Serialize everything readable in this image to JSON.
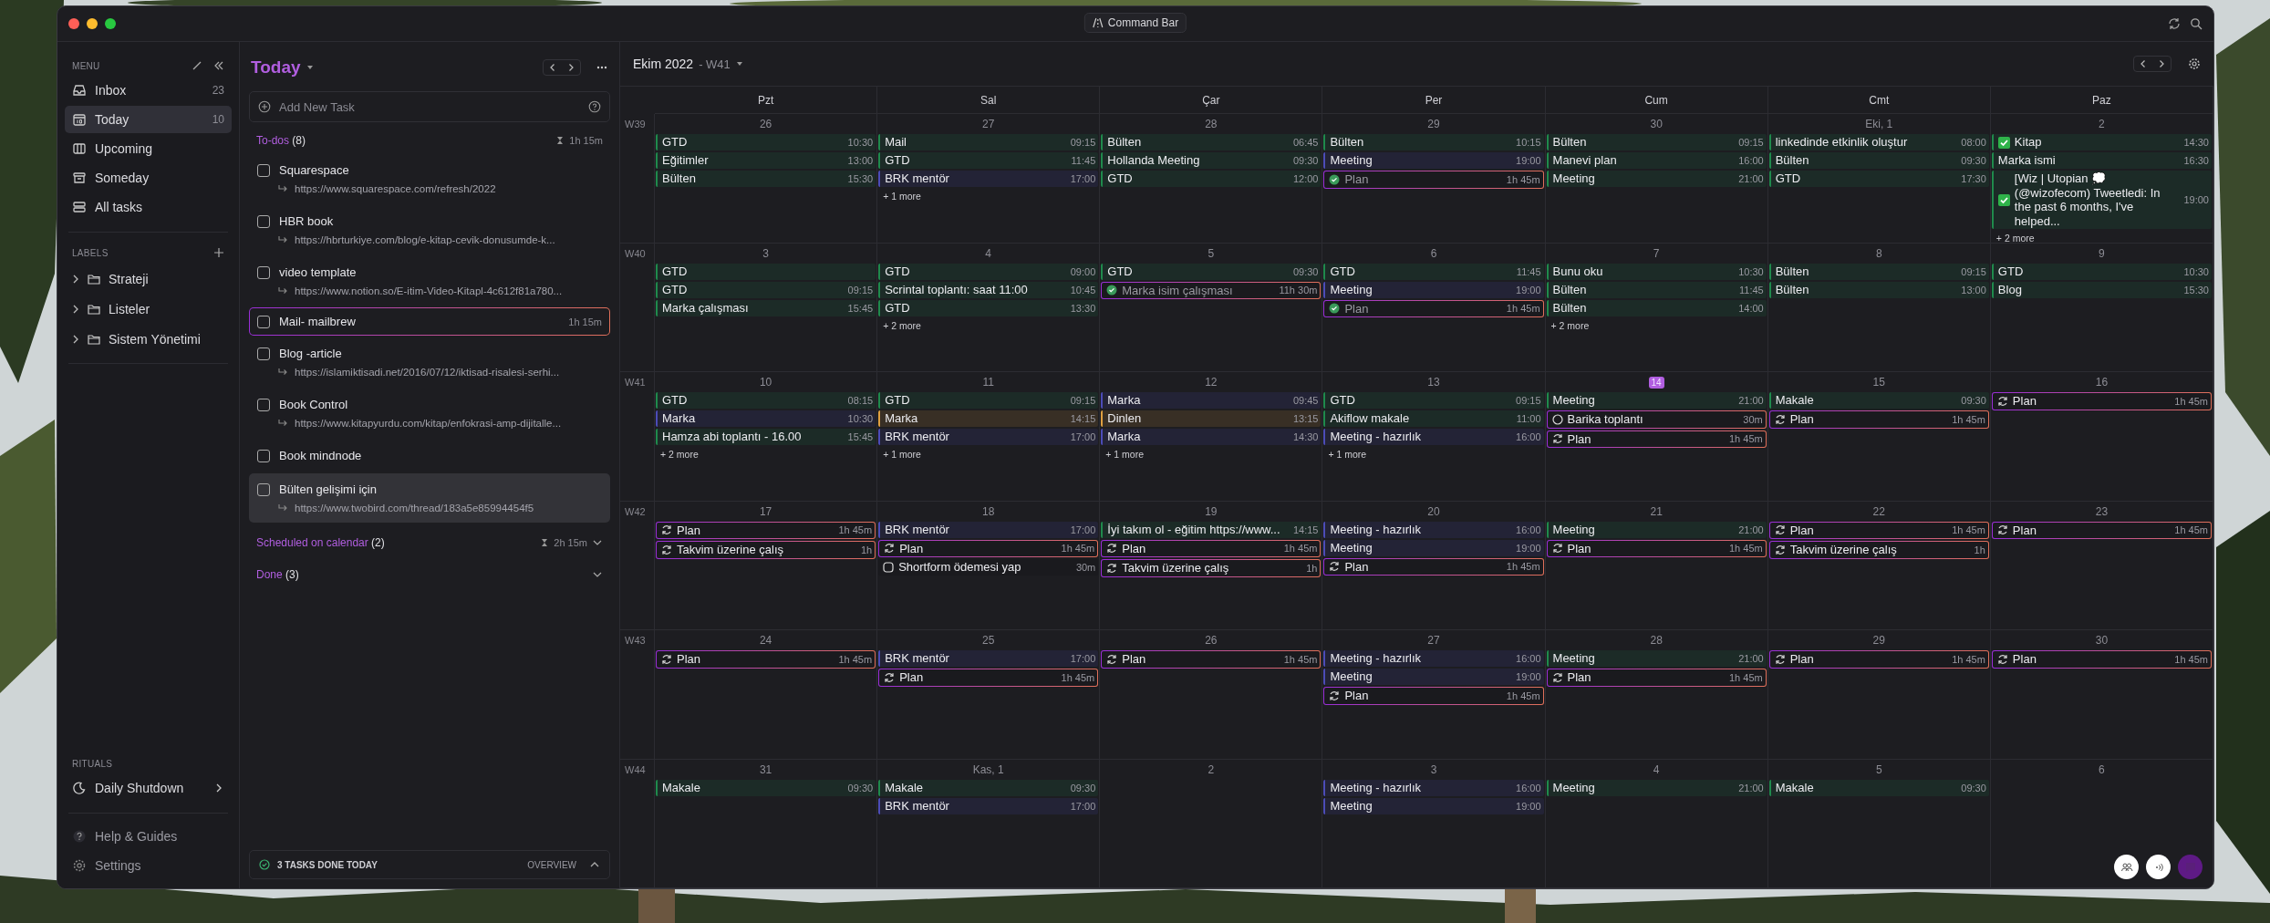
{
  "title_bar": {
    "command_bar": "Command Bar"
  },
  "sidebar": {
    "menu_heading": "MENU",
    "items": [
      {
        "label": "Inbox",
        "count": "23",
        "selected": false
      },
      {
        "label": "Today",
        "count": "10",
        "selected": true
      },
      {
        "label": "Upcoming",
        "selected": false
      },
      {
        "label": "Someday",
        "selected": false
      },
      {
        "label": "All tasks",
        "selected": false
      }
    ],
    "labels_heading": "LABELS",
    "labels": [
      {
        "label": "Strateji",
        "expanded": false
      },
      {
        "label": "Listeler",
        "expanded": false
      },
      {
        "label": "Sistem Yönetimi",
        "expanded": false
      }
    ],
    "rituals_heading": "RITUALS",
    "rituals": [
      {
        "label": "Daily Shutdown"
      }
    ],
    "footer": [
      {
        "label": "Help & Guides"
      },
      {
        "label": "Settings"
      }
    ]
  },
  "task_panel": {
    "title": "Today",
    "add_task": {
      "placeholder": "Add New Task"
    },
    "todos": {
      "label": "To-dos",
      "count": "(8)",
      "duration": "1h 15m"
    },
    "tasks": [
      {
        "title": "Squarespace",
        "url": "https://www.squarespace.com/refresh/2022",
        "scheduled": false,
        "checked": false,
        "selected": false
      },
      {
        "title": "HBR book",
        "url": "https://hbrturkiye.com/blog/e-kitap-cevik-donusumde-k...",
        "scheduled": false,
        "checked": false,
        "selected": false
      },
      {
        "title": "video template",
        "url": "https://www.notion.so/E-itim-Video-Kitapl-4c612f81a780...",
        "scheduled": false,
        "checked": false,
        "selected": false
      },
      {
        "title": "Mail- mailbrew",
        "duration": "1h 15m",
        "scheduled": true,
        "checked": false,
        "selected": false
      },
      {
        "title": "Blog -article",
        "url": "https://islamiktisadi.net/2016/07/12/iktisad-risalesi-serhi...",
        "scheduled": false,
        "checked": false,
        "selected": false
      },
      {
        "title": "Book Control",
        "url": "https://www.kitapyurdu.com/kitap/enfokrasi-amp-dijitalle...",
        "scheduled": false,
        "checked": false,
        "selected": false
      },
      {
        "title": "Book mindnode",
        "scheduled": false,
        "checked": false,
        "selected": false
      },
      {
        "title": "Bülten gelişimi için",
        "url": "https://www.twobird.com/thread/183a5e85994454f5",
        "scheduled": false,
        "checked": false,
        "selected": true
      }
    ],
    "scheduled": {
      "label": "Scheduled on calendar",
      "count": "(2)",
      "duration": "2h 15m",
      "expanded": false
    },
    "done": {
      "label": "Done",
      "count": "(3)",
      "expanded": false
    },
    "footer": {
      "summary": "3 TASKS DONE TODAY",
      "overview": "OVERVIEW"
    }
  },
  "calendar": {
    "month": "Ekim 2022",
    "week": "- W41",
    "day_names": [
      "Pzt",
      "Sal",
      "Çar",
      "Per",
      "Cum",
      "Cmt",
      "Paz"
    ],
    "weeks": [
      {
        "label": "W39",
        "days": [
          {
            "date": "26",
            "events": [
              {
                "kind": "event",
                "title": "GTD",
                "time": "10:30",
                "color": "#1f8a4c"
              },
              {
                "kind": "event",
                "title": "Eğitimler",
                "time": "13:00",
                "color": "#1f8a4c"
              },
              {
                "kind": "event",
                "title": "Bülten",
                "time": "15:30",
                "color": "#1f8a4c"
              }
            ]
          },
          {
            "date": "27",
            "events": [
              {
                "kind": "event",
                "title": "Mail",
                "time": "09:15",
                "color": "#1f8a4c"
              },
              {
                "kind": "event",
                "title": "GTD",
                "time": "11:45",
                "color": "#1f8a4c"
              },
              {
                "kind": "event",
                "title": "BRK mentör",
                "time": "17:00",
                "color": "#4c4cb8"
              }
            ],
            "more": "+ 1 more"
          },
          {
            "date": "28",
            "events": [
              {
                "kind": "event",
                "title": "Bülten",
                "time": "06:45",
                "color": "#1f8a4c"
              },
              {
                "kind": "event",
                "title": "Hollanda Meeting",
                "time": "09:30",
                "color": "#1f8a4c"
              },
              {
                "kind": "event",
                "title": "GTD",
                "time": "12:00",
                "color": "#1f8a4c"
              }
            ]
          },
          {
            "date": "29",
            "events": [
              {
                "kind": "event",
                "title": "Bülten",
                "time": "10:15",
                "color": "#1f8a4c"
              },
              {
                "kind": "event",
                "title": "Meeting",
                "time": "19:00",
                "color": "#4c4cb8"
              },
              {
                "kind": "task",
                "title": "Plan",
                "duration": "1h 45m",
                "checked": true
              }
            ]
          },
          {
            "date": "30",
            "events": [
              {
                "kind": "event",
                "title": "Bülten",
                "time": "09:15",
                "color": "#1f8a4c"
              },
              {
                "kind": "event",
                "title": "Manevi plan",
                "time": "16:00",
                "color": "#1f8a4c"
              },
              {
                "kind": "event",
                "title": "Meeting",
                "time": "21:00",
                "color": "#1f8a4c"
              }
            ]
          },
          {
            "date": "Eki, 1",
            "events": [
              {
                "kind": "event",
                "title": "linkedinde etkinlik oluştur",
                "time": "08:00",
                "color": "#1f8a4c"
              },
              {
                "kind": "event",
                "title": "Bülten",
                "time": "09:30",
                "color": "#1f8a4c"
              },
              {
                "kind": "event",
                "title": "GTD",
                "time": "17:30",
                "color": "#1f8a4c"
              }
            ]
          },
          {
            "date": "2",
            "events": [
              {
                "kind": "event",
                "title": "Kitap",
                "time": "14:30",
                "color": "#1f8a4c",
                "done": true
              },
              {
                "kind": "event",
                "title": "Marka ismi",
                "time": "16:30",
                "color": "#1f8a4c"
              },
              {
                "kind": "event",
                "title": "[Wiz | Utopian 💭 (@wizofecom) Tweetledi: In the past 6 months, I've helped...",
                "time": "19:00",
                "color": "#1f8a4c",
                "done": true
              }
            ],
            "more": "+ 2 more"
          }
        ]
      },
      {
        "label": "W40",
        "days": [
          {
            "date": "3",
            "events": [
              {
                "kind": "event",
                "title": "GTD",
                "color": "#1f8a4c"
              },
              {
                "kind": "event",
                "title": "GTD",
                "time": "09:15",
                "color": "#1f8a4c"
              },
              {
                "kind": "event",
                "title": "Marka çalışması",
                "time": "15:45",
                "color": "#1f8a4c"
              }
            ]
          },
          {
            "date": "4",
            "events": [
              {
                "kind": "event",
                "title": "GTD",
                "time": "09:00",
                "color": "#1f8a4c"
              },
              {
                "kind": "event",
                "title": "Scrintal toplantı: saat 11:00",
                "time": "10:45",
                "color": "#1f8a4c"
              },
              {
                "kind": "event",
                "title": "GTD",
                "time": "13:30",
                "color": "#1f8a4c"
              }
            ],
            "more": "+ 2 more"
          },
          {
            "date": "5",
            "events": [
              {
                "kind": "event",
                "title": "GTD",
                "time": "09:30",
                "color": "#1f8a4c"
              },
              {
                "kind": "task",
                "title": "Marka isim çalışması",
                "duration": "11h 30m",
                "checked": true
              }
            ]
          },
          {
            "date": "6",
            "events": [
              {
                "kind": "event",
                "title": "GTD",
                "time": "11:45",
                "color": "#1f8a4c"
              },
              {
                "kind": "event",
                "title": "Meeting",
                "time": "19:00",
                "color": "#4c4cb8"
              },
              {
                "kind": "task",
                "title": "Plan",
                "duration": "1h 45m",
                "checked": true
              }
            ]
          },
          {
            "date": "7",
            "events": [
              {
                "kind": "event",
                "title": "Bunu oku",
                "time": "10:30",
                "color": "#1f8a4c"
              },
              {
                "kind": "event",
                "title": "Bülten",
                "time": "11:45",
                "color": "#1f8a4c"
              },
              {
                "kind": "event",
                "title": "Bülten",
                "time": "14:00",
                "color": "#1f8a4c"
              }
            ],
            "more": "+ 2 more"
          },
          {
            "date": "8",
            "events": [
              {
                "kind": "event",
                "title": "Bülten",
                "time": "09:15",
                "color": "#1f8a4c"
              },
              {
                "kind": "event",
                "title": "Bülten",
                "time": "13:00",
                "color": "#1f8a4c"
              }
            ]
          },
          {
            "date": "9",
            "events": [
              {
                "kind": "event",
                "title": "GTD",
                "time": "10:30",
                "color": "#1f8a4c"
              },
              {
                "kind": "event",
                "title": "Blog",
                "time": "15:30",
                "color": "#1f8a4c"
              }
            ]
          }
        ]
      },
      {
        "label": "W41",
        "days": [
          {
            "date": "10",
            "events": [
              {
                "kind": "event",
                "title": "GTD",
                "time": "08:15",
                "color": "#1f8a4c"
              },
              {
                "kind": "event",
                "title": "Marka",
                "time": "10:30",
                "color": "#4c4cb8"
              },
              {
                "kind": "event",
                "title": "Hamza abi toplantı - 16.00",
                "time": "15:45",
                "color": "#1f8a4c"
              }
            ],
            "more": "+ 2 more"
          },
          {
            "date": "11",
            "events": [
              {
                "kind": "event",
                "title": "GTD",
                "time": "09:15",
                "color": "#1f8a4c"
              },
              {
                "kind": "event",
                "title": "Marka",
                "time": "14:15",
                "color": "#e0a040"
              },
              {
                "kind": "event",
                "title": "BRK mentör",
                "time": "17:00",
                "color": "#4c4cb8"
              }
            ],
            "more": "+ 1 more"
          },
          {
            "date": "12",
            "events": [
              {
                "kind": "event",
                "title": "Marka",
                "time": "09:45",
                "color": "#4c4cb8"
              },
              {
                "kind": "event",
                "title": "Dinlen",
                "time": "13:15",
                "color": "#e0a040"
              },
              {
                "kind": "event",
                "title": "Marka",
                "time": "14:30",
                "color": "#4c4cb8"
              }
            ],
            "more": "+ 1 more"
          },
          {
            "date": "13",
            "events": [
              {
                "kind": "event",
                "title": "GTD",
                "time": "09:15",
                "color": "#1f8a4c"
              },
              {
                "kind": "event",
                "title": "Akiflow makale",
                "time": "11:00",
                "color": "#1f8a4c"
              },
              {
                "kind": "event",
                "title": "Meeting - hazırlık",
                "time": "16:00",
                "color": "#4c4cb8"
              }
            ],
            "more": "+ 1 more"
          },
          {
            "date": "14",
            "today": true,
            "events": [
              {
                "kind": "event",
                "title": "Meeting",
                "time": "21:00",
                "color": "#1f8a4c"
              },
              {
                "kind": "task",
                "title": "Barika toplantı",
                "duration": "30m",
                "checked": false,
                "recurring": false
              },
              {
                "kind": "task",
                "title": "Plan",
                "duration": "1h 45m",
                "checked": false,
                "recurring": true
              }
            ]
          },
          {
            "date": "15",
            "events": [
              {
                "kind": "event",
                "title": "Makale",
                "time": "09:30",
                "color": "#1f8a4c"
              },
              {
                "kind": "task",
                "title": "Plan",
                "duration": "1h 45m",
                "checked": false,
                "recurring": true
              }
            ]
          },
          {
            "date": "16",
            "events": [
              {
                "kind": "task",
                "title": "Plan",
                "duration": "1h 45m",
                "checked": false,
                "recurring": true
              }
            ]
          }
        ]
      },
      {
        "label": "W42",
        "days": [
          {
            "date": "17",
            "events": [
              {
                "kind": "task",
                "title": "Plan",
                "duration": "1h 45m",
                "checked": false,
                "recurring": true
              },
              {
                "kind": "task",
                "title": "Takvim üzerine çalış",
                "duration": "1h",
                "checked": false,
                "recurring": true
              }
            ]
          },
          {
            "date": "18",
            "events": [
              {
                "kind": "event",
                "title": "BRK mentör",
                "time": "17:00",
                "color": "#4c4cb8"
              },
              {
                "kind": "task",
                "title": "Plan",
                "duration": "1h 45m",
                "checked": false,
                "recurring": true
              },
              {
                "kind": "todo",
                "title": "Shortform ödemesi yap",
                "duration": "30m",
                "checked": false
              }
            ]
          },
          {
            "date": "19",
            "events": [
              {
                "kind": "event",
                "title": "İyi takım ol - eğitim https://www...",
                "time": "14:15",
                "color": "#1f8a4c"
              },
              {
                "kind": "task",
                "title": "Plan",
                "duration": "1h 45m",
                "checked": false,
                "recurring": true
              },
              {
                "kind": "task",
                "title": "Takvim üzerine çalış",
                "duration": "1h",
                "checked": false,
                "recurring": true
              }
            ]
          },
          {
            "date": "20",
            "events": [
              {
                "kind": "event",
                "title": "Meeting - hazırlık",
                "time": "16:00",
                "color": "#4c4cb8"
              },
              {
                "kind": "event",
                "title": "Meeting",
                "time": "19:00",
                "color": "#4c4cb8"
              },
              {
                "kind": "task",
                "title": "Plan",
                "duration": "1h 45m",
                "checked": false,
                "recurring": true
              }
            ]
          },
          {
            "date": "21",
            "events": [
              {
                "kind": "event",
                "title": "Meeting",
                "time": "21:00",
                "color": "#1f8a4c"
              },
              {
                "kind": "task",
                "title": "Plan",
                "duration": "1h 45m",
                "checked": false,
                "recurring": true
              }
            ]
          },
          {
            "date": "22",
            "events": [
              {
                "kind": "task",
                "title": "Plan",
                "duration": "1h 45m",
                "checked": false,
                "recurring": true
              },
              {
                "kind": "task",
                "title": "Takvim üzerine çalış",
                "duration": "1h",
                "checked": false,
                "recurring": true
              }
            ]
          },
          {
            "date": "23",
            "events": [
              {
                "kind": "task",
                "title": "Plan",
                "duration": "1h 45m",
                "checked": false,
                "recurring": true
              }
            ]
          }
        ]
      },
      {
        "label": "W43",
        "days": [
          {
            "date": "24",
            "events": [
              {
                "kind": "task",
                "title": "Plan",
                "duration": "1h 45m",
                "checked": false,
                "recurring": true
              }
            ]
          },
          {
            "date": "25",
            "events": [
              {
                "kind": "event",
                "title": "BRK mentör",
                "time": "17:00",
                "color": "#4c4cb8"
              },
              {
                "kind": "task",
                "title": "Plan",
                "duration": "1h 45m",
                "checked": false,
                "recurring": true
              }
            ]
          },
          {
            "date": "26",
            "events": [
              {
                "kind": "task",
                "title": "Plan",
                "duration": "1h 45m",
                "checked": false,
                "recurring": true
              }
            ]
          },
          {
            "date": "27",
            "events": [
              {
                "kind": "event",
                "title": "Meeting - hazırlık",
                "time": "16:00",
                "color": "#4c4cb8"
              },
              {
                "kind": "event",
                "title": "Meeting",
                "time": "19:00",
                "color": "#4c4cb8"
              },
              {
                "kind": "task",
                "title": "Plan",
                "duration": "1h 45m",
                "checked": false,
                "recurring": true
              }
            ]
          },
          {
            "date": "28",
            "events": [
              {
                "kind": "event",
                "title": "Meeting",
                "time": "21:00",
                "color": "#1f8a4c"
              },
              {
                "kind": "task",
                "title": "Plan",
                "duration": "1h 45m",
                "checked": false,
                "recurring": true
              }
            ]
          },
          {
            "date": "29",
            "events": [
              {
                "kind": "task",
                "title": "Plan",
                "duration": "1h 45m",
                "checked": false,
                "recurring": true
              }
            ]
          },
          {
            "date": "30",
            "events": [
              {
                "kind": "task",
                "title": "Plan",
                "duration": "1h 45m",
                "checked": false,
                "recurring": true
              }
            ]
          }
        ]
      },
      {
        "label": "W44",
        "days": [
          {
            "date": "31",
            "events": [
              {
                "kind": "event",
                "title": "Makale",
                "time": "09:30",
                "color": "#1f8a4c"
              }
            ]
          },
          {
            "date": "Kas, 1",
            "events": [
              {
                "kind": "event",
                "title": "Makale",
                "time": "09:30",
                "color": "#1f8a4c"
              },
              {
                "kind": "event",
                "title": "BRK mentör",
                "time": "17:00",
                "color": "#4c4cb8"
              }
            ]
          },
          {
            "date": "2"
          },
          {
            "date": "3",
            "events": [
              {
                "kind": "event",
                "title": "Meeting - hazırlık",
                "time": "16:00",
                "color": "#4c4cb8"
              },
              {
                "kind": "event",
                "title": "Meeting",
                "time": "19:00",
                "color": "#4c4cb8"
              }
            ]
          },
          {
            "date": "4",
            "events": [
              {
                "kind": "event",
                "title": "Meeting",
                "time": "21:00",
                "color": "#1f8a4c"
              }
            ]
          },
          {
            "date": "5",
            "events": [
              {
                "kind": "event",
                "title": "Makale",
                "time": "09:30",
                "color": "#1f8a4c"
              }
            ]
          },
          {
            "date": "6"
          }
        ]
      }
    ]
  }
}
